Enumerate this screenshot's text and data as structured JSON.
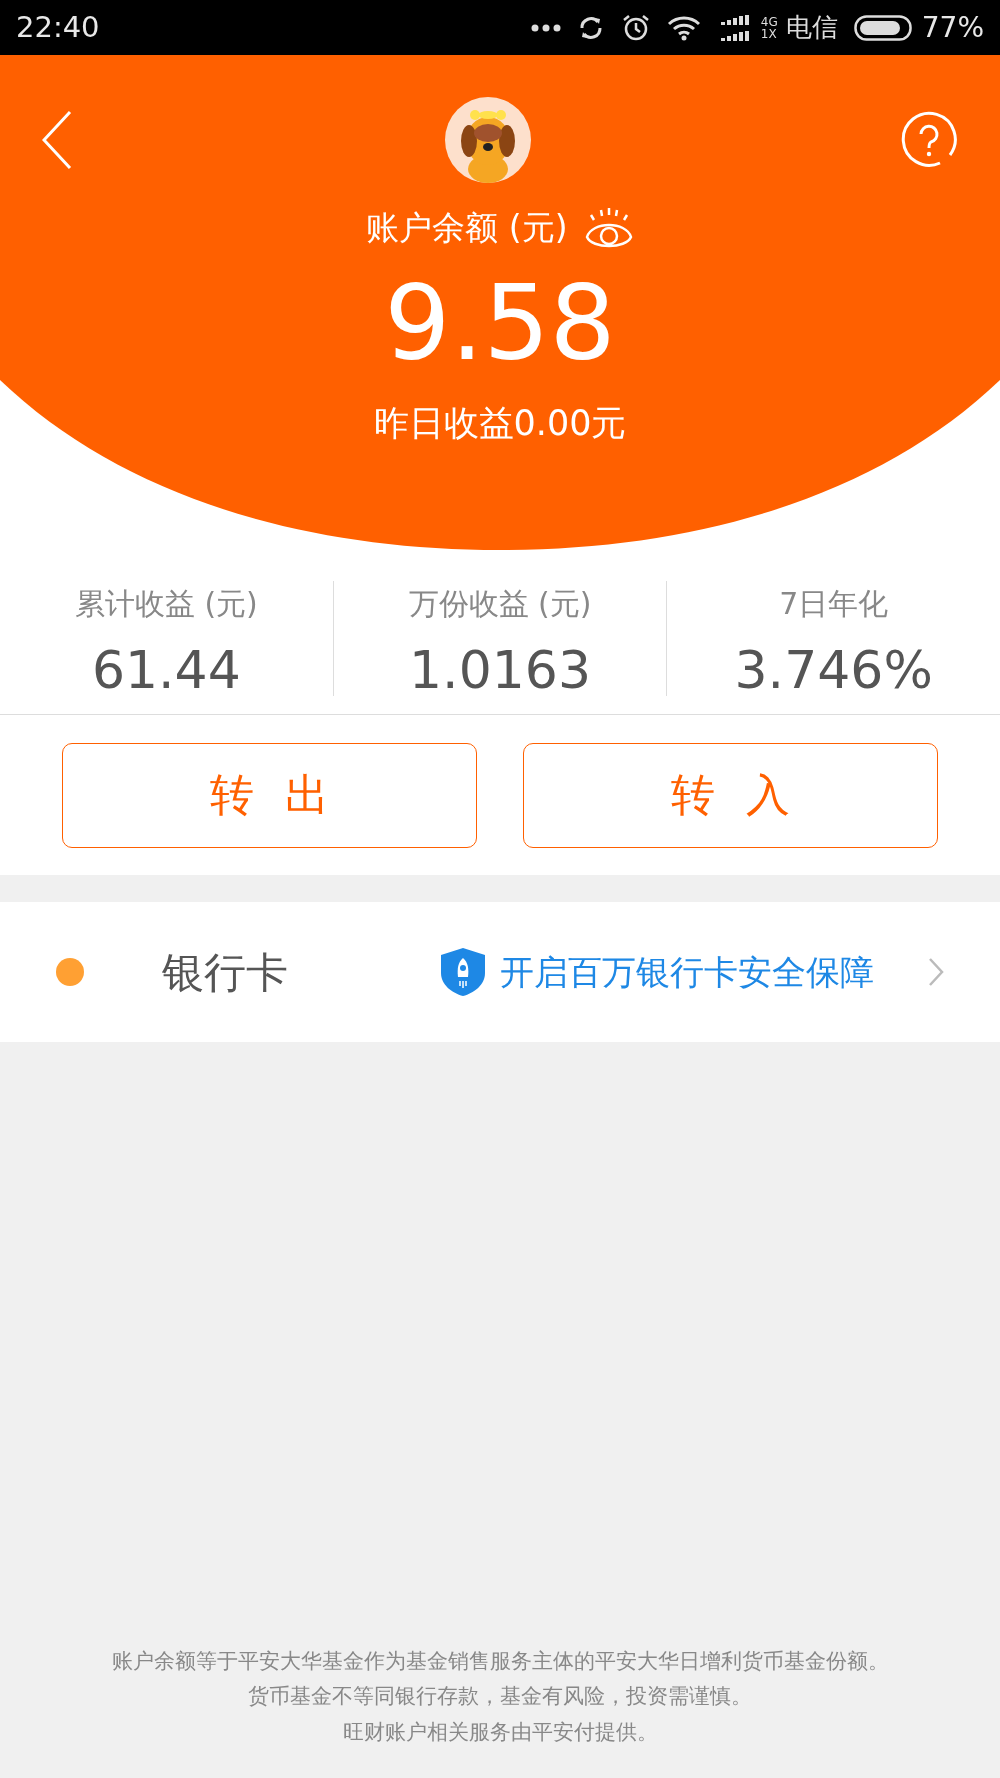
{
  "status_bar": {
    "time": "22:40",
    "network_top": "4G",
    "network_bottom": "1X",
    "carrier": "电信",
    "battery": "77%"
  },
  "header": {
    "balance_label": "账户余额 (元)",
    "balance": "9.58",
    "yesterday": "昨日收益0.00元"
  },
  "stats": [
    {
      "label": "累计收益 (元)",
      "value": "61.44"
    },
    {
      "label": "万份收益 (元)",
      "value": "1.0163"
    },
    {
      "label": "7日年化",
      "value": "3.746%"
    }
  ],
  "buttons": [
    "转出",
    "转入"
  ],
  "bank_row": {
    "label": "银行卡",
    "color": "#ffa033",
    "link": "开启百万银行卡安全保障"
  },
  "footer": [
    "账户余额等于平安大华基金作为基金销售服务主体的平安大华日增利货币基金份额。",
    "货币基金不等同银行存款，基金有风险，投资需谨慎。",
    "旺财账户相关服务由平安付提供。"
  ]
}
